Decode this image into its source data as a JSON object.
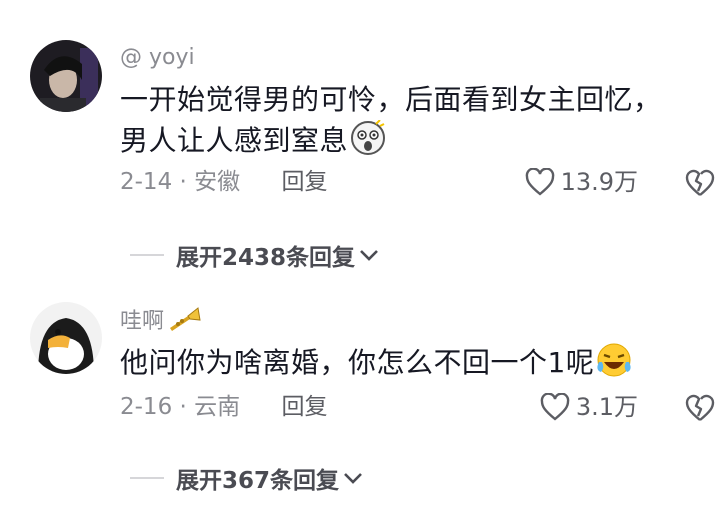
{
  "comments": [
    {
      "username": "@ yoyi",
      "text_line1": "一开始觉得男的可怜，后面看到女主回忆，",
      "text_line2": "男人让人感到窒息",
      "trailing_emoji": "shocked-face-icon",
      "date_location": "2-14 · 安徽",
      "reply_label": "回复",
      "like_count": "13.9万",
      "expand_label": "展开2438条回复"
    },
    {
      "username": "哇啊",
      "username_badge": "trumpet-icon",
      "text": "他问你为啥离婚，你怎么不回一个1呢",
      "trailing_emoji": "laughing-tears-icon",
      "date_location": "2-16 · 云南",
      "reply_label": "回复",
      "like_count": "3.1万",
      "expand_label": "展开367条回复"
    }
  ],
  "colors": {
    "primary_text": "#161823",
    "secondary_text": "#8a8b91",
    "divider": "#d6d6d9"
  }
}
